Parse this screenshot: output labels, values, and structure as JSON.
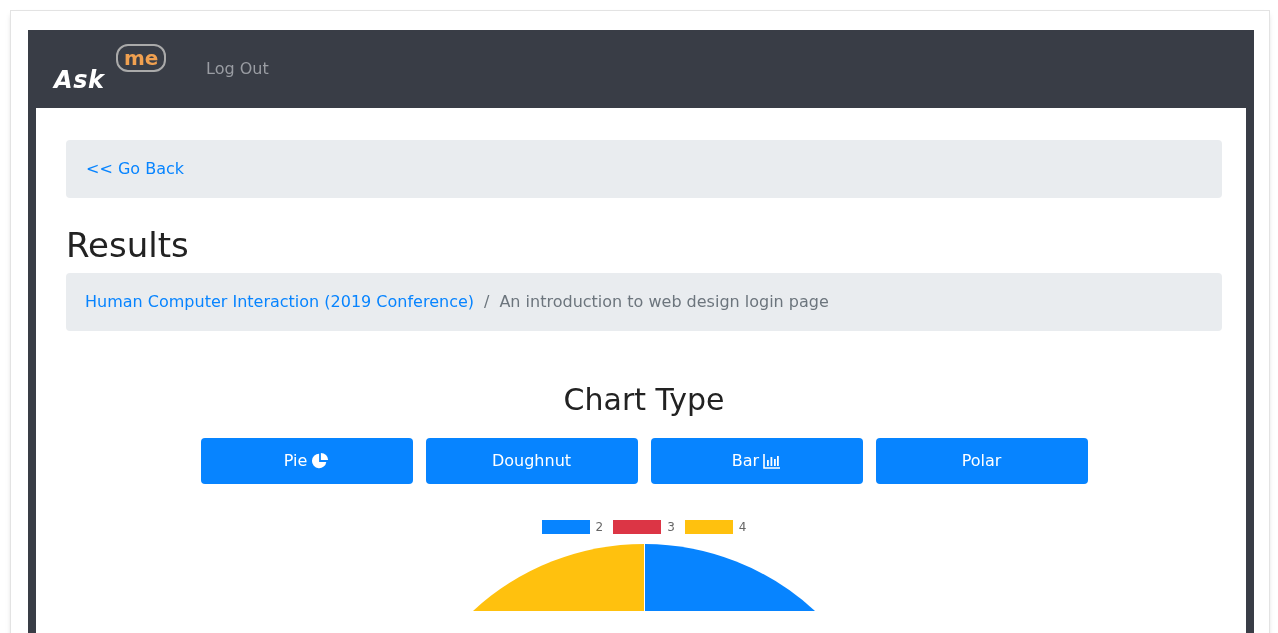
{
  "navbar": {
    "logo": {
      "word": "Ask",
      "bubble": "me"
    },
    "links": [
      "Log Out"
    ]
  },
  "back_link": "<< Go Back",
  "title": "Results",
  "breadcrumb": [
    {
      "label": "Human Computer Interaction (2019 Conference)",
      "kind": "link"
    },
    {
      "label": "An introduction to web design login page",
      "kind": "current"
    }
  ],
  "separator": "/",
  "chart_section": {
    "heading": "Chart Type",
    "buttons": [
      {
        "label": "Pie",
        "kind": "pie"
      },
      {
        "label": "Doughnut",
        "kind": "plain"
      },
      {
        "label": "Bar",
        "kind": "bar"
      },
      {
        "label": "Polar",
        "kind": "plain"
      }
    ],
    "legend": [
      {
        "label": "2",
        "color": "#0784ff"
      },
      {
        "label": "3",
        "color": "#dc3545"
      },
      {
        "label": "4",
        "color": "#ffc10e"
      }
    ]
  }
}
